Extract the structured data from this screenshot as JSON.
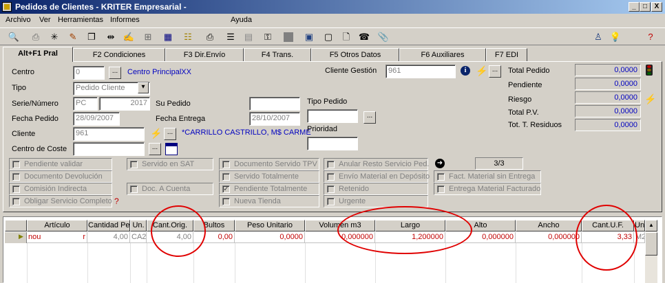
{
  "window": {
    "title": "Pedidos de Clientes - KRITER Empresarial -",
    "controls": {
      "minimize": "_",
      "maximize": "□",
      "close": "X"
    }
  },
  "menu": {
    "items": [
      "Archivo",
      "Ver",
      "Herramientas",
      "Informes",
      "Ayuda"
    ]
  },
  "toolbar": {
    "icons": [
      "preview-icon",
      "print-icon",
      "tools-icon",
      "brush-icon",
      "copy-icon",
      "split-icon",
      "edit-icon",
      "tree-icon",
      "calendar-icon",
      "chart-icon",
      "printer-icon",
      "list-icon",
      "table-icon",
      "key-icon",
      "stop-icon",
      "grid-icon",
      "save-icon",
      "doc-icon",
      "phone-icon",
      "clip-icon"
    ],
    "right_icons": [
      "user-icon",
      "bulb-icon",
      "help-icon"
    ]
  },
  "tabs": [
    "Alt+F1 Pral",
    "F2 Condiciones",
    "F3 Dir.Envío",
    "F4 Trans.",
    "F5 Otros Datos",
    "F6 Auxiliares",
    "F7 EDI"
  ],
  "form": {
    "centro_label": "Centro",
    "centro_value": "0",
    "centro_name": "Centro PrincipalXX",
    "tipo_label": "Tipo",
    "tipo_value": "Pedido Cliente",
    "serie_label": "Serie/Número",
    "serie_value": "PC",
    "numero_value": "2017",
    "su_pedido_label": "Su Pedido",
    "su_pedido_value": "",
    "fecha_pedido_label": "Fecha Pedido",
    "fecha_pedido_value": "28/09/2007",
    "fecha_entrega_label": "Fecha Entrega",
    "fecha_entrega_value": "28/10/2007",
    "cliente_label": "Cliente",
    "cliente_value": "961",
    "cliente_name": "*CARRILLO CASTRILLO, M$ CARME",
    "centro_coste_label": "Centro de Coste",
    "centro_coste_value": "",
    "cliente_gestion_label": "Cliente Gestión",
    "cliente_gestion_value": "961",
    "tipo_pedido_label": "Tipo Pedido",
    "tipo_pedido_value": "",
    "prioridad_label": "Prioridad",
    "prioridad_value": ""
  },
  "summary": [
    {
      "label": "Total Pedido",
      "value": "0,0000"
    },
    {
      "label": "Pendiente",
      "value": "0,0000"
    },
    {
      "label": "Riesgo",
      "value": "0,0000"
    },
    {
      "label": "Total P.V.",
      "value": "0,0000"
    },
    {
      "label": "Tot. T. Residuos",
      "value": "0,0000"
    }
  ],
  "checks": {
    "col1": [
      "Pendiente validar",
      "Documento Devolución",
      "Comisión Indirecta",
      "Obligar Servicio Completo"
    ],
    "col2": [
      "Servido en SAT",
      "Doc. A Cuenta"
    ],
    "col3": [
      "Documento Servido TPV",
      "Servido Totalmente",
      "Pendiente Totalmente",
      "Nueva Tienda"
    ],
    "col4": [
      "Anular Resto Servicio Ped.",
      "Envío Material en Depósito",
      "Retenido",
      "Urgente"
    ],
    "col5": [
      "Fact. Material sin Entrega",
      "Entrega Material Facturado"
    ],
    "counter": "3/3"
  },
  "grid": {
    "headers": [
      "Artículo",
      "Cantidad Pendie",
      "Un.",
      "Cant.Orig.",
      "Bultos",
      "Peso Unitario",
      "Volumen m3",
      "Largo",
      "Alto",
      "Ancho",
      "Cant.U.F.",
      "Un"
    ],
    "row": [
      "nou",
      "r",
      "4,00",
      "CA2",
      "4,00",
      "0,00",
      "0,0000",
      "0,000000",
      "1,200000",
      "0,000000",
      "0,000000",
      "3,33",
      "M2"
    ]
  }
}
